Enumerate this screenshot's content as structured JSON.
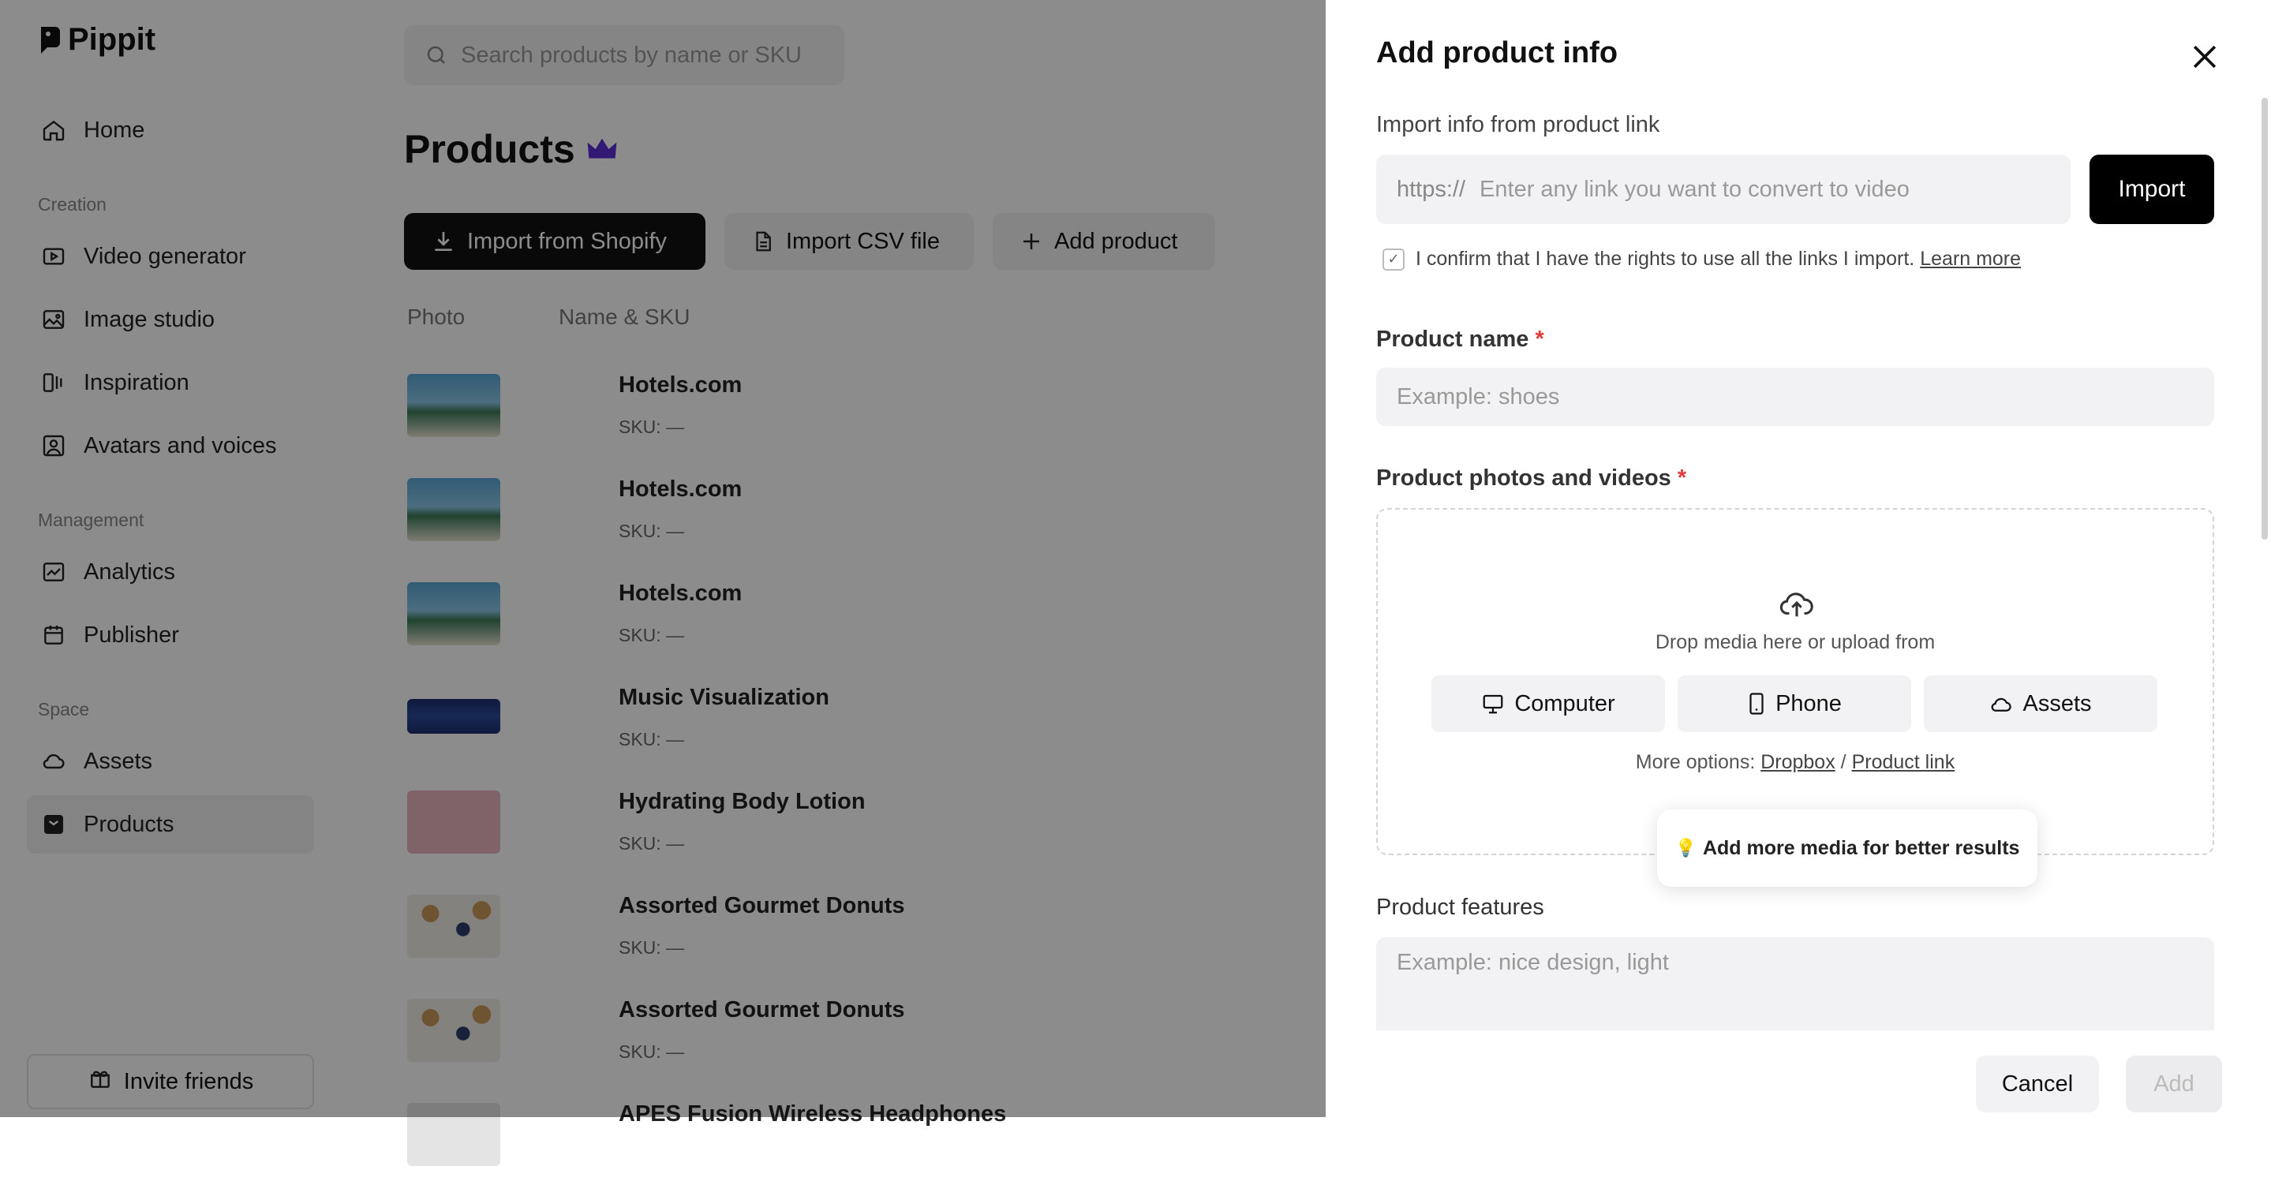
{
  "app": {
    "name": "Pippit"
  },
  "sidebar": {
    "items_top": [
      {
        "label": "Home",
        "icon": "home-icon"
      }
    ],
    "sections": [
      {
        "title": "Creation",
        "items": [
          {
            "label": "Video generator",
            "icon": "video-icon"
          },
          {
            "label": "Image studio",
            "icon": "image-icon"
          },
          {
            "label": "Inspiration",
            "icon": "inspiration-icon"
          },
          {
            "label": "Avatars and voices",
            "icon": "avatar-icon"
          }
        ]
      },
      {
        "title": "Management",
        "items": [
          {
            "label": "Analytics",
            "icon": "analytics-icon"
          },
          {
            "label": "Publisher",
            "icon": "calendar-icon"
          }
        ]
      },
      {
        "title": "Space",
        "items": [
          {
            "label": "Assets",
            "icon": "cloud-icon"
          },
          {
            "label": "Products",
            "icon": "products-icon",
            "active": true
          }
        ]
      }
    ],
    "invite_label": "Invite friends"
  },
  "main": {
    "search_placeholder": "Search products by name or SKU",
    "title": "Products",
    "buttons": {
      "import_shopify": "Import from Shopify",
      "import_csv": "Import CSV file",
      "add_product": "Add product"
    },
    "columns": {
      "photo": "Photo",
      "name_sku": "Name & SKU"
    },
    "rows": [
      {
        "name": "Hotels.com",
        "sku": "SKU: —",
        "thumb": "beach"
      },
      {
        "name": "Hotels.com",
        "sku": "SKU: —",
        "thumb": "beach"
      },
      {
        "name": "Hotels.com",
        "sku": "SKU: —",
        "thumb": "beach"
      },
      {
        "name": "Music Visualization",
        "sku": "SKU: —",
        "thumb": "wave"
      },
      {
        "name": "Hydrating Body Lotion",
        "sku": "SKU: —",
        "thumb": "lotion"
      },
      {
        "name": "Assorted Gourmet Donuts",
        "sku": "SKU: —",
        "thumb": "donuts"
      },
      {
        "name": "Assorted Gourmet Donuts",
        "sku": "SKU: —",
        "thumb": "donuts"
      },
      {
        "name": "APES Fusion Wireless Headphones",
        "sku": "",
        "thumb": "headphones"
      }
    ]
  },
  "panel": {
    "title": "Add product info",
    "import_label": "Import info from product link",
    "url_prefix": "https://",
    "url_placeholder": "Enter any link you want to convert to video",
    "import_button": "Import",
    "confirm_text": "I confirm that I have the rights to use all the links I import.",
    "learn_more": "Learn more",
    "product_name_label": "Product name",
    "required_mark": "*",
    "product_name_placeholder": "Example: shoes",
    "media_label": "Product photos and videos",
    "drop_text": "Drop media here or upload from",
    "upload_buttons": {
      "computer": "Computer",
      "phone": "Phone",
      "assets": "Assets"
    },
    "more_options": "More options:",
    "dropbox": "Dropbox",
    "separator": "/",
    "product_link": "Product link",
    "tooltip": "Add more media for better results",
    "tooltip_emoji": "💡",
    "features_label": "Product features",
    "features_placeholder": "Example: nice design, light",
    "cancel": "Cancel",
    "add": "Add"
  }
}
